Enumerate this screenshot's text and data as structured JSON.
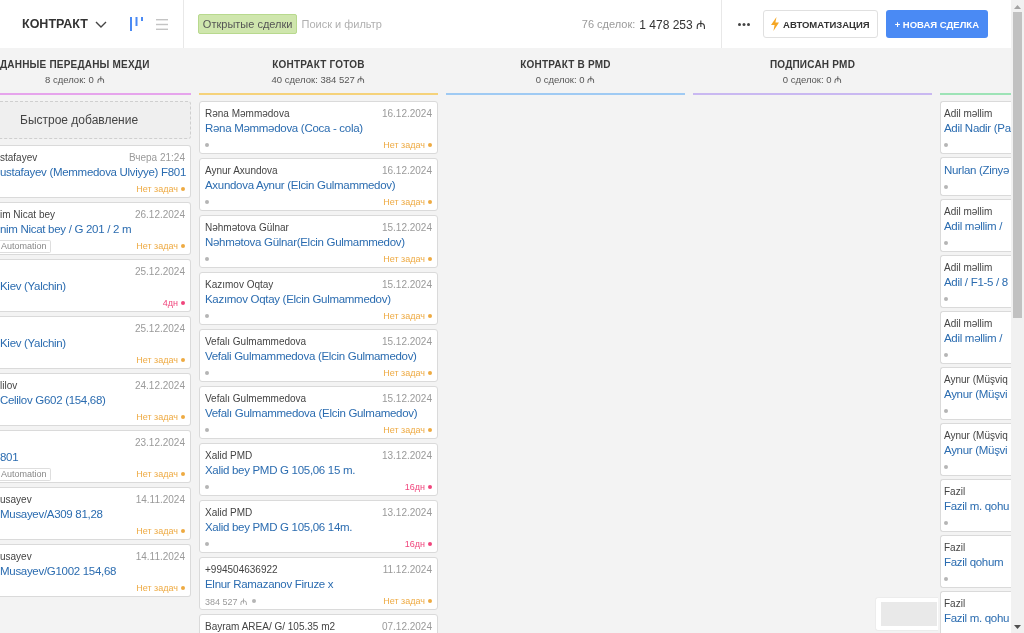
{
  "toolbar": {
    "pipeline": "КОНТРАКТ",
    "views": [
      {
        "kind": "board",
        "selected": true
      },
      {
        "kind": "list",
        "selected": false
      }
    ],
    "filter_tag": "Открытые сделки",
    "search": {
      "placeholder": "Поиск и фильтр"
    },
    "deal_count": "76 сделок:",
    "total": "1 478 253 ₼",
    "actions": [
      {
        "kind": "more"
      },
      {
        "kind": "automation",
        "label": "АВТОМАТИЗАЦИЯ"
      },
      {
        "kind": "primary",
        "label": "+ НОВАЯ СДЕЛКА"
      }
    ]
  },
  "columns": [
    {
      "kind": "clipped_left",
      "title": "ДАННЫЕ ПЕРЕДАНЫ МЕХДИ",
      "count": "8 сделок: 0 ₼",
      "color": "#e6a4ec",
      "quick_add": "Быстрое добавление",
      "cards": [
        {
          "contact": "stafayev",
          "date": "Вчера 21:24",
          "title": "ustafayev (Memmedova Ulviyye) F801",
          "task": {
            "kind": "none",
            "text": "Нет задач"
          }
        },
        {
          "contact": "im Nicat bey",
          "date": "26.12.2024",
          "title": "nim Nicat bey / G 201 / 2 m",
          "tags": [
            "Automation"
          ],
          "task": {
            "kind": "none",
            "text": "Нет задач"
          }
        },
        {
          "date": "25.12.2024",
          "title": "Kiev (Yalchin)",
          "task": {
            "kind": "overdue",
            "text": "4дн"
          }
        },
        {
          "date": "25.12.2024",
          "title": "Kiev (Yalchin)",
          "task": {
            "kind": "none",
            "text": "Нет задач"
          }
        },
        {
          "contact": "lilov",
          "date": "24.12.2024",
          "title": "Celilov G602 (154,68)",
          "task": {
            "kind": "none",
            "text": "Нет задач"
          }
        },
        {
          "date": "23.12.2024",
          "title": "801",
          "tags": [
            "Automation"
          ],
          "task": {
            "kind": "none",
            "text": "Нет задач"
          }
        },
        {
          "contact": "usayev",
          "date": "14.11.2024",
          "title": "Musayev/A309 81,28",
          "task": {
            "kind": "none",
            "text": "Нет задач"
          }
        },
        {
          "contact": "usayev",
          "date": "14.11.2024",
          "title": "Musayev/G1002 154,68",
          "task": {
            "kind": "none",
            "text": "Нет задач"
          }
        }
      ]
    },
    {
      "kind": "full",
      "title": "КОНТРАКТ ГОТОВ",
      "count": "40 сделок: 384 527 ₼",
      "color": "#f5d27a",
      "cards": [
        {
          "contact": "Rəna Məmmədova",
          "date": "16.12.2024",
          "title": "Rəna Məmmədova (Coca - cola)",
          "task": {
            "kind": "none",
            "text": "Нет задач"
          }
        },
        {
          "contact": "Aynur Axundova",
          "date": "16.12.2024",
          "title": "Axundova Aynur (Elcin Gulmammedov)",
          "task": {
            "kind": "none",
            "text": "Нет задач"
          }
        },
        {
          "contact": "Nəhmətova Gülnar",
          "date": "15.12.2024",
          "title": "Nəhmətova Gülnar(Elcin Gulmammedov)",
          "task": {
            "kind": "none",
            "text": "Нет задач"
          }
        },
        {
          "contact": "Kazımov Oqtay",
          "date": "15.12.2024",
          "title": "Kazımov Oqtay (Elcin Gulmammedov)",
          "task": {
            "kind": "none",
            "text": "Нет задач"
          }
        },
        {
          "contact": "Vefalı Gulmammedova",
          "date": "15.12.2024",
          "title": "Vefali Gulmammedova (Elcin Gulmamedov)",
          "task": {
            "kind": "none",
            "text": "Нет задач"
          }
        },
        {
          "contact": "Vefalı Gulmemmedova",
          "date": "15.12.2024",
          "title": "Vefalı Gulmammedova (Elcin Gulmamedov)",
          "task": {
            "kind": "none",
            "text": "Нет задач"
          }
        },
        {
          "contact": "Xalid PMD",
          "date": "13.12.2024",
          "title": "Xalid bey PMD G 105,06 15 m.",
          "task": {
            "kind": "overdue",
            "text": "16дн"
          }
        },
        {
          "contact": "Xalid PMD",
          "date": "13.12.2024",
          "title": "Xalid bey PMD G 105,06 14m.",
          "task": {
            "kind": "overdue",
            "text": "16дн"
          }
        },
        {
          "contact": "+994504636922",
          "date": "11.12.2024",
          "title": "Elnur Ramazanov Firuze x",
          "price": "384 527 ₼",
          "task": {
            "kind": "none",
            "text": "Нет задач"
          }
        },
        {
          "contact": "Bayram AREA/ G/ 105.35 m2",
          "date": "07.12.2024"
        }
      ]
    },
    {
      "kind": "full",
      "title": "КОНТРАКТ В PMD",
      "count": "0 сделок: 0 ₼",
      "color": "#9fcaf3"
    },
    {
      "kind": "full",
      "title": "ПОДПИСАН PMD",
      "count": "0 сделок: 0 ₼",
      "color": "#c9b8f1"
    },
    {
      "kind": "clipped_right",
      "color": "#9de3b6",
      "cards": [
        {
          "contact": "Adil məllim",
          "title": "Adil Nadir (Pa"
        },
        {
          "title": "Nurlan (Zinyə"
        },
        {
          "contact": "Adil məllim",
          "title": "Adil məllim /"
        },
        {
          "contact": "Adil məllim",
          "title": "Adil / F1-5 / 8"
        },
        {
          "contact": "Adil məllim",
          "title": "Adil məllim /"
        },
        {
          "contact": "Aynur (Müşviq",
          "title": "Aynur (Müşvi"
        },
        {
          "contact": "Aynur (Müşviq",
          "title": "Aynur (Müşvi"
        },
        {
          "contact": "Fazil",
          "title": "Fazil m. qohu"
        },
        {
          "contact": "Fazil",
          "title": "Fazil qohum"
        },
        {
          "contact": "Fazil",
          "title": "Fazil m. qohu"
        }
      ]
    }
  ]
}
